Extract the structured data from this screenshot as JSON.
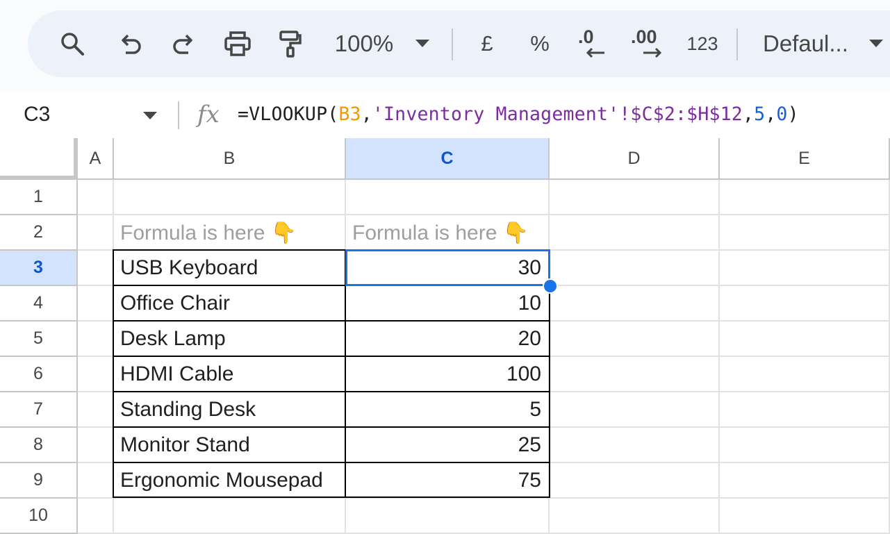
{
  "toolbar": {
    "zoom": "100%",
    "currency_label": "£",
    "percent_label": "%",
    "decrease_decimal_label": ".0",
    "increase_decimal_label": ".00",
    "number_format_label": "123",
    "font_label": "Defaul..."
  },
  "formula_bar": {
    "name_box": "C3",
    "fx_label": "fx",
    "formula_parts": {
      "p1": "=VLOOKUP(",
      "p2": "B3",
      "p3": ",",
      "p4": "'Inventory Management'!$C$2:$H$12",
      "p5": ",",
      "p6": "5",
      "p7": ",",
      "p8": "0",
      "p9": ")"
    }
  },
  "grid": {
    "columns": [
      "A",
      "B",
      "C",
      "D",
      "E"
    ],
    "rows": [
      "1",
      "2",
      "3",
      "4",
      "5",
      "6",
      "7",
      "8",
      "9",
      "10"
    ],
    "hint_b": "Formula is here 👇",
    "hint_c": "Formula is here 👇",
    "items": [
      {
        "name": "USB Keyboard",
        "qty": "30"
      },
      {
        "name": "Office Chair",
        "qty": "10"
      },
      {
        "name": "Desk Lamp",
        "qty": "20"
      },
      {
        "name": "HDMI Cable",
        "qty": "100"
      },
      {
        "name": "Standing Desk",
        "qty": "5"
      },
      {
        "name": "Monitor Stand",
        "qty": "25"
      },
      {
        "name": "Ergonomic Mousepad",
        "qty": "75"
      }
    ],
    "selected_cell": "C3",
    "colors": {
      "selection": "#1a73e8",
      "header_active": "#d3e3fd",
      "formula_reference": "#f29900",
      "formula_range": "#7b2c9e",
      "formula_number": "#1a5fd0"
    }
  }
}
